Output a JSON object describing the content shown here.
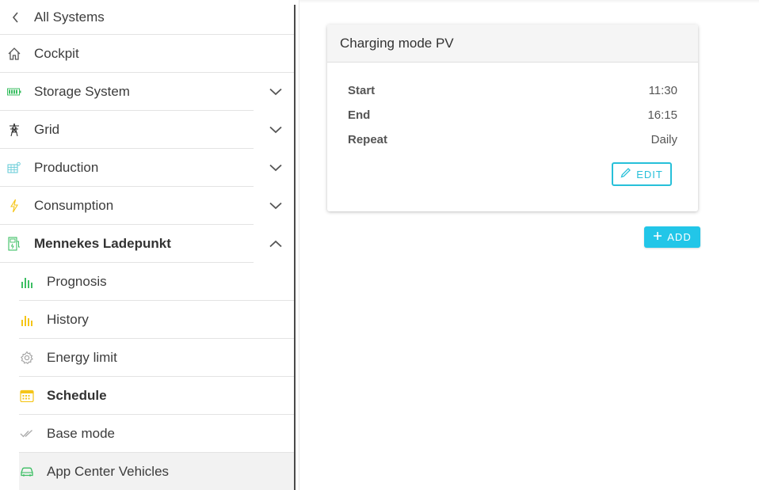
{
  "sidebar": {
    "back_label": "All Systems",
    "items": [
      {
        "label": "Cockpit"
      },
      {
        "label": "Storage System"
      },
      {
        "label": "Grid"
      },
      {
        "label": "Production"
      },
      {
        "label": "Consumption"
      },
      {
        "label": "Mennekes Ladepunkt"
      }
    ],
    "sub_items": [
      {
        "label": "Prognosis"
      },
      {
        "label": "History"
      },
      {
        "label": "Energy limit"
      },
      {
        "label": "Schedule"
      },
      {
        "label": "Base mode"
      },
      {
        "label": "App Center Vehicles"
      }
    ]
  },
  "card": {
    "title": "Charging mode PV",
    "rows": [
      {
        "key": "Start",
        "value": "11:30"
      },
      {
        "key": "End",
        "value": "16:15"
      },
      {
        "key": "Repeat",
        "value": "Daily"
      }
    ],
    "edit_label": "EDIT"
  },
  "add_label": "ADD",
  "colors": {
    "accent": "#22c6e8",
    "green": "#3cbf63",
    "yellow": "#f5c518",
    "teal": "#5fc9d6"
  }
}
